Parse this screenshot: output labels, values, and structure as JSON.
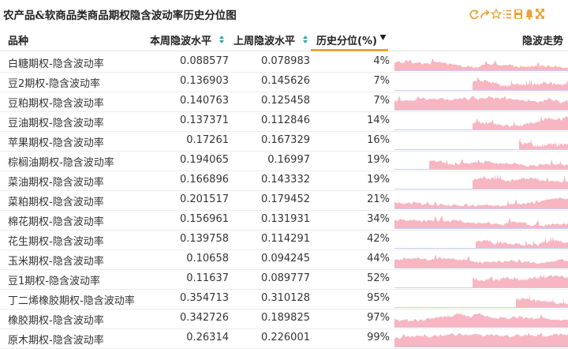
{
  "page": {
    "title": "农产品&软商品类商品期权隐含波动率历史分位图"
  },
  "toolbar": {
    "icons": [
      "refresh-icon",
      "share-icon",
      "star-icon",
      "list-icon",
      "save-icon",
      "bell-icon",
      "fullscreen-icon"
    ],
    "color": "#e8a33d"
  },
  "table": {
    "headers": {
      "name": "品种",
      "current": "本周隐波水平",
      "previous": "上周隐波水平",
      "percentile": "历史分位(%)",
      "trend": "隐波走势"
    },
    "sort_arrow_color": "#2aa8a0",
    "spark_color": "#f7b6c2",
    "spark_baseline_color": "#c9cdf0",
    "rows": [
      {
        "name": "白糖期权-隐含波动率",
        "current": "0.088577",
        "previous": "0.078983",
        "percentile": "4%"
      },
      {
        "name": "豆2期权-隐含波动率",
        "current": "0.136903",
        "previous": "0.145626",
        "percentile": "7%"
      },
      {
        "name": "豆粕期权-隐含波动率",
        "current": "0.140763",
        "previous": "0.125458",
        "percentile": "7%"
      },
      {
        "name": "豆油期权-隐含波动率",
        "current": "0.137371",
        "previous": "0.112846",
        "percentile": "14%"
      },
      {
        "name": "苹果期权-隐含波动率",
        "current": "0.17261",
        "previous": "0.167329",
        "percentile": "16%"
      },
      {
        "name": "棕榈油期权-隐含波动率",
        "current": "0.194065",
        "previous": "0.16997",
        "percentile": "19%"
      },
      {
        "name": "菜油期权-隐含波动率",
        "current": "0.166896",
        "previous": "0.143332",
        "percentile": "19%"
      },
      {
        "name": "菜粕期权-隐含波动率",
        "current": "0.201517",
        "previous": "0.179452",
        "percentile": "21%"
      },
      {
        "name": "棉花期权-隐含波动率",
        "current": "0.156961",
        "previous": "0.131931",
        "percentile": "34%"
      },
      {
        "name": "花生期权-隐含波动率",
        "current": "0.139758",
        "previous": "0.114291",
        "percentile": "42%"
      },
      {
        "name": "玉米期权-隐含波动率",
        "current": "0.10658",
        "previous": "0.094245",
        "percentile": "44%"
      },
      {
        "name": "豆1期权-隐含波动率",
        "current": "0.11637",
        "previous": "0.089777",
        "percentile": "52%"
      },
      {
        "name": "丁二烯橡胶期权-隐含波动率",
        "current": "0.354713",
        "previous": "0.310128",
        "percentile": "95%"
      },
      {
        "name": "橡胶期权-隐含波动率",
        "current": "0.342726",
        "previous": "0.189825",
        "percentile": "97%"
      },
      {
        "name": "原木期权-隐含波动率",
        "current": "0.26314",
        "previous": "0.226001",
        "percentile": "99%"
      }
    ]
  }
}
